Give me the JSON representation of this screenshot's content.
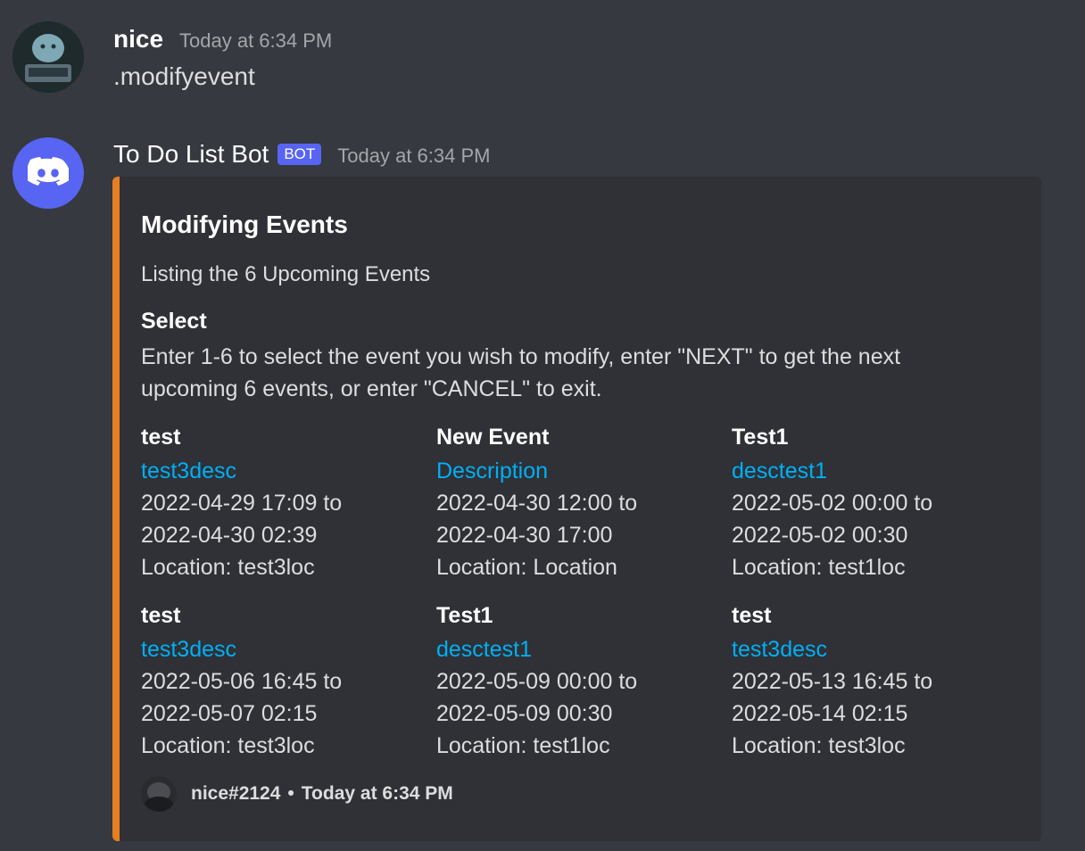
{
  "message1": {
    "username": "nice",
    "timestamp": "Today at 6:34 PM",
    "content": ".modifyevent"
  },
  "message2": {
    "username": "To Do List Bot",
    "bot_tag": "BOT",
    "timestamp": "Today at 6:34 PM"
  },
  "embed": {
    "accent_color": "#e67e22",
    "title": "Modifying Events",
    "description": "Listing the 6 Upcoming Events",
    "select_name": "Select",
    "select_value": "Enter 1-6 to select the event you wish to modify, enter \"NEXT\" to get the next upcoming 6 events, or enter \"CANCEL\" to exit.",
    "events": [
      {
        "title": "test",
        "desc": "test3desc",
        "line1": "2022-04-29 17:09 to",
        "line2": "2022-04-30 02:39",
        "location": "Location: test3loc"
      },
      {
        "title": "New Event",
        "desc": "Description",
        "line1": "2022-04-30 12:00 to",
        "line2": "2022-04-30 17:00",
        "location": "Location: Location"
      },
      {
        "title": "Test1",
        "desc": "desctest1",
        "line1": "2022-05-02 00:00 to",
        "line2": "2022-05-02 00:30",
        "location": "Location: test1loc"
      },
      {
        "title": "test",
        "desc": "test3desc",
        "line1": "2022-05-06 16:45 to",
        "line2": "2022-05-07 02:15",
        "location": "Location: test3loc"
      },
      {
        "title": "Test1",
        "desc": "desctest1",
        "line1": "2022-05-09 00:00 to",
        "line2": "2022-05-09 00:30",
        "location": "Location: test1loc"
      },
      {
        "title": "test",
        "desc": "test3desc",
        "line1": "2022-05-13 16:45 to",
        "line2": "2022-05-14 02:15",
        "location": "Location: test3loc"
      }
    ],
    "footer_user": "nice#2124",
    "footer_separator": "•",
    "footer_time": "Today at 6:34 PM"
  }
}
